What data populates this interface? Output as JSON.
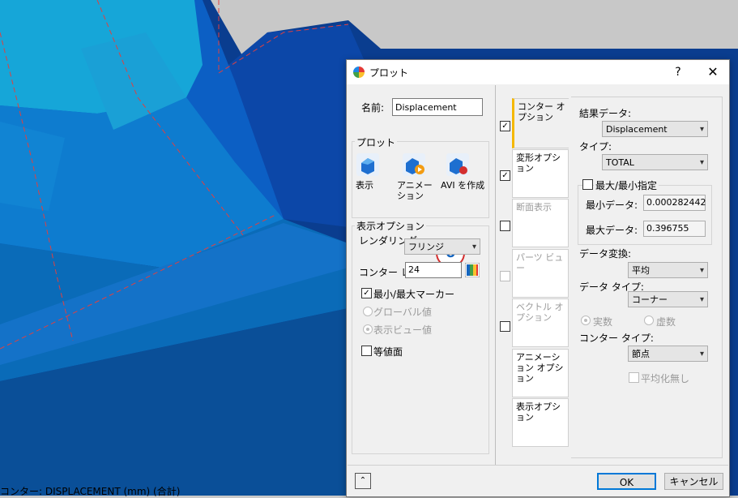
{
  "viewport": {
    "status_text": "コンター: DISPLACEMENT (mm) (合計)"
  },
  "dialog": {
    "title": "プロット",
    "help": "?",
    "close": "✕"
  },
  "left": {
    "name_label": "名前:",
    "name_value": "Displacement",
    "plot_group": "プロット",
    "plot_buttons": [
      {
        "label": "表示",
        "icon": "display-icon"
      },
      {
        "label": "アニメーション",
        "icon": "animation-icon"
      },
      {
        "label": "AVI を作成",
        "icon": "avi-icon"
      }
    ],
    "display_options": "表示オプション",
    "badge": "6",
    "rendering_label": "レンダリング :",
    "rendering_value": "フリンジ",
    "contour_label": "コンター レ",
    "contour_value": "24",
    "minmax_marker": "最小/最大マーカー",
    "global_value": "グローバル値",
    "view_value": "表示ビュー値",
    "isosurface": "等値面"
  },
  "tabs": [
    {
      "label": "コンター オプション",
      "checked": true
    },
    {
      "label": "変形オプション",
      "checked": true
    },
    {
      "label": "断面表示",
      "checked": false
    },
    {
      "label": "パーツ ビュー",
      "checked": false
    },
    {
      "label": "ベクトル オプション",
      "checked": false
    },
    {
      "label": "アニメーション オプション"
    },
    {
      "label": "表示オプション"
    }
  ],
  "right": {
    "result_data_label": "結果データ:",
    "result_data_value": "Displacement",
    "type_label": "タイプ:",
    "type_value": "TOTAL",
    "minmax_specify": "最大/最小指定",
    "min_data_label": "最小データ:",
    "min_data_value": "0.000282442",
    "max_data_label": "最大データ:",
    "max_data_value": "0.396755",
    "data_conv_label": "データ変換:",
    "data_conv_value": "平均",
    "data_type_label": "データ タイプ:",
    "data_type_value": "コーナー",
    "real": "実数",
    "imaginary": "虚数",
    "contour_type_label": "コンター タイプ:",
    "contour_type_value": "節点",
    "no_averaging": "平均化無し"
  },
  "footer": {
    "expand": "⌃",
    "ok": "OK",
    "cancel": "キャンセル"
  },
  "colors": {
    "accent": "#f5b800",
    "ok_border": "#0078d7",
    "badge_red": "#d32f2f",
    "badge_blue": "#1565c0"
  }
}
